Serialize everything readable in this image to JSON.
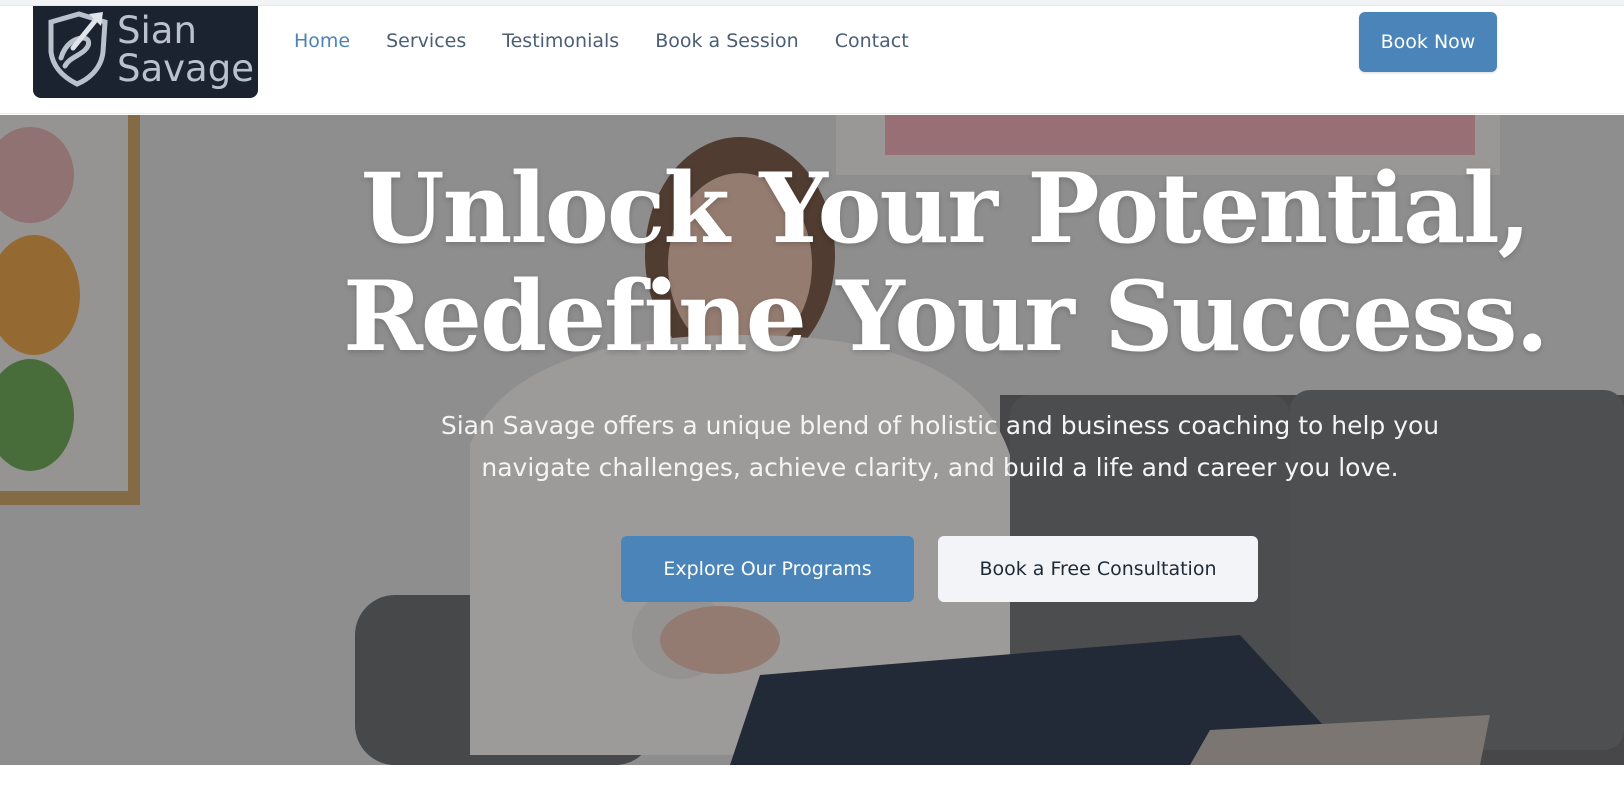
{
  "brand": {
    "logo_line1": "Sian",
    "logo_line2": "Savage",
    "logo_icon": "shield-arrow-logo-icon"
  },
  "nav": {
    "items": [
      {
        "label": "Home",
        "active": true
      },
      {
        "label": "Services",
        "active": false
      },
      {
        "label": "Testimonials",
        "active": false
      },
      {
        "label": "Book a Session",
        "active": false
      },
      {
        "label": "Contact",
        "active": false
      }
    ],
    "cta_label": "Book Now"
  },
  "hero": {
    "title_line1": "Unlock Your Potential,",
    "title_line2": "Redefine Your Success.",
    "subtitle_line1": "Sian Savage offers a unique blend of holistic and business coaching to help you",
    "subtitle_line2": "navigate challenges, achieve clarity, and build a life and career you love.",
    "primary_button": "Explore Our Programs",
    "secondary_button": "Book a Free Consultation"
  },
  "colors": {
    "accent": "#4a84b8",
    "nav_text": "#4b5e73",
    "logo_bg": "#1c2330",
    "hero_overlay": "#28282c",
    "secondary_button_bg": "#f2f4f7"
  }
}
